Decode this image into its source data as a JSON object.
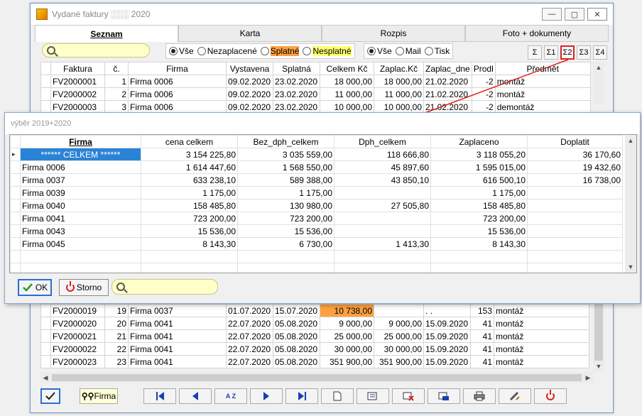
{
  "window": {
    "title": "Vydané faktury ░░░ 2020",
    "minimize": "—",
    "maximize": "▢",
    "close": "✕"
  },
  "tabs": [
    "Seznam",
    "Karta",
    "Rozpis",
    "Foto + dokumenty"
  ],
  "filters": {
    "search_placeholder": "",
    "status_options": [
      "Vše",
      "Nezaplacené",
      "Splatné",
      "Nesplatné"
    ],
    "status_selected": "Vše",
    "send_options": [
      "Vše",
      "Mail",
      "Tisk"
    ],
    "send_selected": "Vše",
    "sum_buttons": [
      "Σ",
      "Σ1",
      "Σ2",
      "Σ3",
      "Σ4"
    ],
    "sum_selected": "Σ2",
    "highlight_colors": {
      "splatne": "#ffa040",
      "nesplatne": "#ffff70"
    }
  },
  "main_table": {
    "columns": [
      "Faktura",
      "č.",
      "Firma",
      "Vystavena",
      "Splatná",
      "Celkem Kč",
      "Zaplac.Kč",
      "Zaplac_dne",
      "Prodl",
      "Předmět"
    ],
    "rows_top": [
      [
        "FV2000001",
        "1",
        "Firma 0006",
        "09.02.2020",
        "23.02.2020",
        "18 000,00",
        "18 000,00",
        "21.02.2020",
        "-2",
        "montáž"
      ],
      [
        "FV2000002",
        "2",
        "Firma 0006",
        "09.02.2020",
        "23.02.2020",
        "11 000,00",
        "11 000,00",
        "21.02.2020",
        "-2",
        "montáž"
      ],
      [
        "FV2000003",
        "3",
        "Firma 0006",
        "09.02.2020",
        "23.02.2020",
        "10 000,00",
        "10 000,00",
        "21.02.2020",
        "-2",
        "demontáž"
      ]
    ],
    "rows_bottom": [
      [
        "FV2000019",
        "19",
        "Firma 0037",
        "01.07.2020",
        "15.07.2020",
        "10 738,00",
        "",
        ". .",
        "153",
        "montáž"
      ],
      [
        "FV2000020",
        "20",
        "Firma 0041",
        "22.07.2020",
        "05.08.2020",
        "9 000,00",
        "9 000,00",
        "15.09.2020",
        "41",
        "montáž"
      ],
      [
        "FV2000021",
        "21",
        "Firma 0041",
        "22.07.2020",
        "05.08.2020",
        "25 000,00",
        "25 000,00",
        "15.09.2020",
        "41",
        "montáž"
      ],
      [
        "FV2000022",
        "22",
        "Firma 0041",
        "22.07.2020",
        "05.08.2020",
        "30 000,00",
        "30 000,00",
        "15.09.2020",
        "41",
        "montáž"
      ],
      [
        "FV2000023",
        "23",
        "Firma 0041",
        "22.07.2020",
        "05.08.2020",
        "351 900,00",
        "351 900,00",
        "15.09.2020",
        "41",
        "montáž"
      ]
    ]
  },
  "bottom_toolbar": {
    "firma_label": "Firma",
    "sort_label": "A Z"
  },
  "dialog": {
    "title": "výběr 2019+2020",
    "columns": [
      "Firma",
      "cena celkem",
      "Bez_dph_celkem",
      "Dph_celkem",
      "Zaplaceno",
      "Doplatit"
    ],
    "rows": [
      [
        "****** CELKEM ******",
        "3 154 225,80",
        "3 035 559,00",
        "118 666,80",
        "3 118 055,20",
        "36 170,60"
      ],
      [
        "Firma 0006",
        "1 614 447,60",
        "1 568 550,00",
        "45 897,60",
        "1 595 015,00",
        "19 432,60"
      ],
      [
        "Firma 0037",
        "633 238,10",
        "589 388,00",
        "43 850,10",
        "616 500,10",
        "16 738,00"
      ],
      [
        "Firma 0039",
        "1 175,00",
        "1 175,00",
        "",
        "1 175,00",
        ""
      ],
      [
        "Firma 0040",
        "158 485,80",
        "130 980,00",
        "27 505,80",
        "158 485,80",
        ""
      ],
      [
        "Firma 0041",
        "723 200,00",
        "723 200,00",
        "",
        "723 200,00",
        ""
      ],
      [
        "Firma 0043",
        "15 536,00",
        "15 536,00",
        "",
        "15 536,00",
        ""
      ],
      [
        "Firma 0045",
        "8 143,30",
        "6 730,00",
        "1 413,30",
        "8 143,30",
        ""
      ]
    ],
    "ok_label": "OK",
    "storno_label": "Storno"
  }
}
